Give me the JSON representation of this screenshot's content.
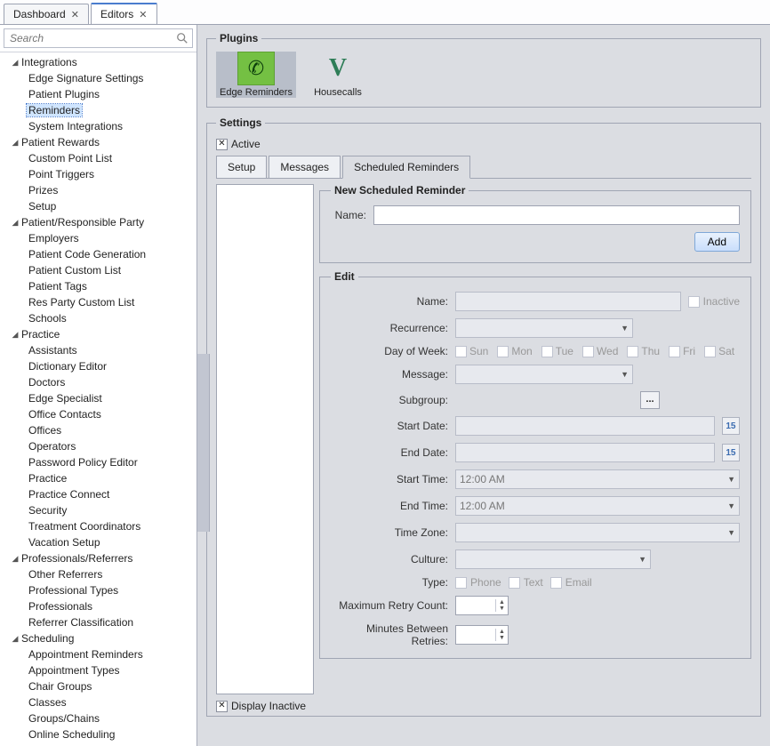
{
  "doc_tabs": [
    {
      "label": "Dashboard",
      "active": false
    },
    {
      "label": "Editors",
      "active": true
    }
  ],
  "search": {
    "placeholder": "Search"
  },
  "tree": [
    {
      "label": "Integrations",
      "expanded": true,
      "children": [
        {
          "label": "Edge Signature Settings"
        },
        {
          "label": "Patient Plugins"
        },
        {
          "label": "Reminders",
          "selected": true
        },
        {
          "label": "System Integrations"
        }
      ]
    },
    {
      "label": "Patient Rewards",
      "expanded": true,
      "children": [
        {
          "label": "Custom Point List"
        },
        {
          "label": "Point Triggers"
        },
        {
          "label": "Prizes"
        },
        {
          "label": "Setup"
        }
      ]
    },
    {
      "label": "Patient/Responsible Party",
      "expanded": true,
      "children": [
        {
          "label": "Employers"
        },
        {
          "label": "Patient Code Generation"
        },
        {
          "label": "Patient Custom List"
        },
        {
          "label": "Patient Tags"
        },
        {
          "label": "Res Party Custom List"
        },
        {
          "label": "Schools"
        }
      ]
    },
    {
      "label": "Practice",
      "expanded": true,
      "children": [
        {
          "label": "Assistants"
        },
        {
          "label": "Dictionary Editor"
        },
        {
          "label": "Doctors"
        },
        {
          "label": "Edge Specialist"
        },
        {
          "label": "Office Contacts"
        },
        {
          "label": "Offices"
        },
        {
          "label": "Operators"
        },
        {
          "label": "Password Policy Editor"
        },
        {
          "label": "Practice"
        },
        {
          "label": "Practice Connect"
        },
        {
          "label": "Security"
        },
        {
          "label": "Treatment Coordinators"
        },
        {
          "label": "Vacation Setup"
        }
      ]
    },
    {
      "label": "Professionals/Referrers",
      "expanded": true,
      "children": [
        {
          "label": "Other Referrers"
        },
        {
          "label": "Professional Types"
        },
        {
          "label": "Professionals"
        },
        {
          "label": "Referrer Classification"
        }
      ]
    },
    {
      "label": "Scheduling",
      "expanded": true,
      "children": [
        {
          "label": "Appointment Reminders"
        },
        {
          "label": "Appointment Types"
        },
        {
          "label": "Chair Groups"
        },
        {
          "label": "Classes"
        },
        {
          "label": "Groups/Chains"
        },
        {
          "label": "Online Scheduling"
        }
      ]
    }
  ],
  "plugins": {
    "legend": "Plugins",
    "items": [
      {
        "label": "Edge Reminders",
        "glyph": "✆",
        "selected": true,
        "kind": "phone"
      },
      {
        "label": "Housecalls",
        "glyph": "V",
        "selected": false,
        "kind": "v"
      }
    ]
  },
  "settings": {
    "legend": "Settings",
    "active_label": "Active",
    "active_checked": true,
    "tabs": [
      {
        "label": "Setup",
        "active": false
      },
      {
        "label": "Messages",
        "active": false
      },
      {
        "label": "Scheduled Reminders",
        "active": true
      }
    ],
    "new_reminder": {
      "legend": "New Scheduled Reminder",
      "name_label": "Name:",
      "name_value": "",
      "add_label": "Add"
    },
    "edit": {
      "legend": "Edit",
      "name_label": "Name:",
      "name_value": "",
      "inactive_label": "Inactive",
      "inactive_checked": false,
      "recurrence_label": "Recurrence:",
      "recurrence_value": "",
      "dow_label": "Day of Week:",
      "days": [
        "Sun",
        "Mon",
        "Tue",
        "Wed",
        "Thu",
        "Fri",
        "Sat"
      ],
      "message_label": "Message:",
      "message_value": "",
      "subgroup_label": "Subgroup:",
      "subgroup_glyph": "...",
      "start_date_label": "Start Date:",
      "start_date_value": "",
      "end_date_label": "End Date:",
      "end_date_value": "",
      "date_glyph": "15",
      "start_time_label": "Start Time:",
      "start_time_value": "12:00 AM",
      "end_time_label": "End Time:",
      "end_time_value": "12:00 AM",
      "time_zone_label": "Time Zone:",
      "time_zone_value": "",
      "culture_label": "Culture:",
      "culture_value": "",
      "type_label": "Type:",
      "type_phone": "Phone",
      "type_text": "Text",
      "type_email": "Email",
      "max_retry_label": "Maximum Retry Count:",
      "max_retry_value": "",
      "mins_retry_label": "Minutes Between Retries:",
      "mins_retry_value": ""
    },
    "display_inactive_label": "Display Inactive",
    "display_inactive_checked": true
  }
}
